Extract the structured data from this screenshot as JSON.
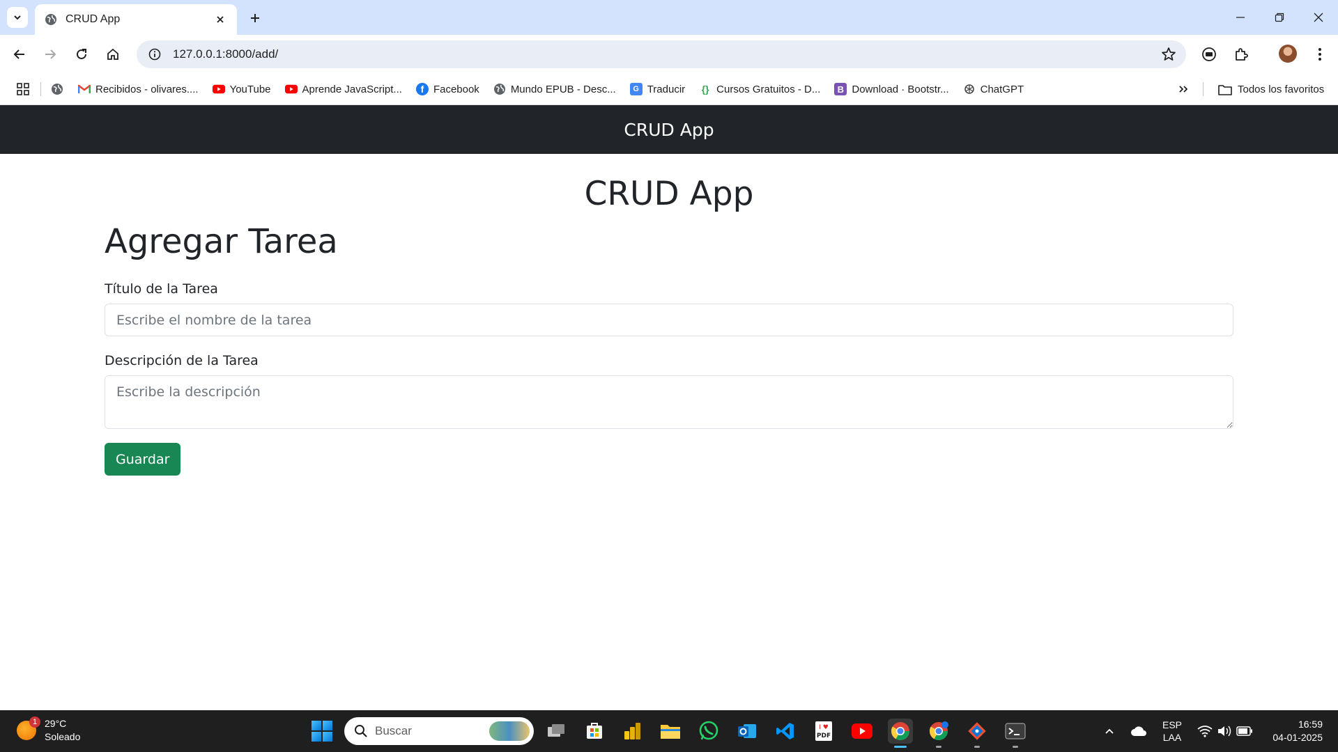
{
  "browser": {
    "tab_title": "CRUD App",
    "url": "127.0.0.1:8000/add/",
    "bookmarks": [
      {
        "label": "Recibidos - olivares....",
        "icon": "gmail-icon",
        "color": "#ea4335"
      },
      {
        "label": "YouTube",
        "icon": "youtube-icon",
        "color": "#ff0000"
      },
      {
        "label": "Aprende JavaScript...",
        "icon": "youtube-icon",
        "color": "#ff0000"
      },
      {
        "label": "Facebook",
        "icon": "facebook-icon",
        "color": "#1877f2"
      },
      {
        "label": "Mundo EPUB - Desc...",
        "icon": "globe-icon",
        "color": "#5f6368"
      },
      {
        "label": "Traducir",
        "icon": "translate-icon",
        "color": "#4285f4"
      },
      {
        "label": "Cursos Gratuitos - D...",
        "icon": "code-braces-icon",
        "color": "#34a853"
      },
      {
        "label": "Download · Bootstr...",
        "icon": "bootstrap-icon",
        "color": "#7952b3"
      },
      {
        "label": "ChatGPT",
        "icon": "chatgpt-icon",
        "color": "#444746"
      }
    ],
    "all_bookmarks_label": "Todos los favoritos"
  },
  "app": {
    "navbar_brand": "CRUD App",
    "main_title": "CRUD App",
    "page_title": "Agregar Tarea",
    "form": {
      "title_label": "Título de la Tarea",
      "title_placeholder": "Escribe el nombre de la tarea",
      "title_value": "",
      "description_label": "Descripción de la Tarea",
      "description_placeholder": "Escribe la descripción",
      "description_value": "",
      "save_label": "Guardar"
    },
    "colors": {
      "navbar": "#212529",
      "save_button": "#198754"
    }
  },
  "taskbar": {
    "weather_temp": "29°C",
    "weather_desc": "Soleado",
    "weather_badge": "1",
    "search_label": "Buscar",
    "pinned_apps": [
      "task-view-icon",
      "microsoft-store-icon",
      "power-bi-icon",
      "file-explorer-icon",
      "whatsapp-icon",
      "outlook-icon",
      "vscode-icon",
      "pdf-reader-icon",
      "youtube-app-icon",
      "chrome-icon",
      "chrome-profile-icon",
      "git-icon",
      "terminal-icon"
    ],
    "language_top": "ESP",
    "language_bottom": "LAA",
    "time": "16:59",
    "date": "04-01-2025"
  }
}
